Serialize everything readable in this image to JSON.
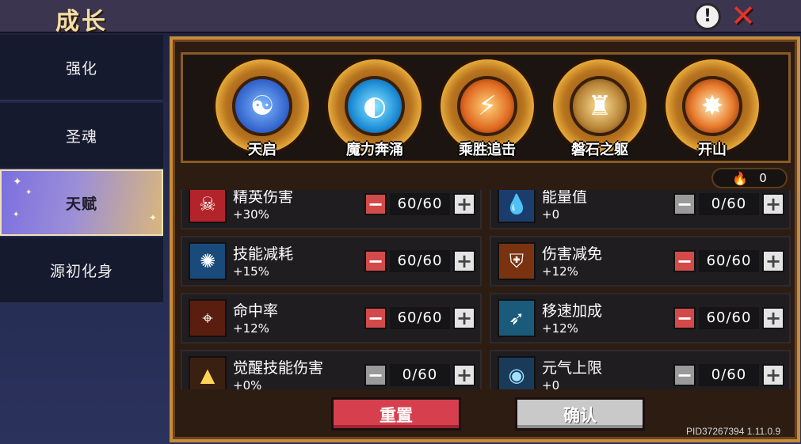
{
  "header": {
    "title": "成长",
    "info_icon": "exclamation-icon",
    "close_icon": "close-icon"
  },
  "sidebar": {
    "items": [
      {
        "label": "强化"
      },
      {
        "label": "圣魂"
      },
      {
        "label": "天赋",
        "active": true
      },
      {
        "label": "源初化身"
      }
    ]
  },
  "skills": [
    {
      "label": "天启",
      "color": "#3a6fd8"
    },
    {
      "label": "魔力奔涌",
      "color": "#1f7fd1"
    },
    {
      "label": "乘胜追击",
      "color": "#d8652a"
    },
    {
      "label": "磐石之躯",
      "color": "#8a5a25"
    },
    {
      "label": "开山",
      "color": "#c8461f"
    }
  ],
  "fire_points": "0",
  "talents": [
    {
      "name": "精英伤害",
      "bonus": "+30%",
      "value": "60/60",
      "minus_active": true,
      "icon": "demon-skull-icon",
      "icon_color": "#b3242a"
    },
    {
      "name": "能量值",
      "bonus": "+0",
      "value": "0/60",
      "minus_active": false,
      "icon": "water-drop-icon",
      "icon_color": "#1a3d6e"
    },
    {
      "name": "技能减耗",
      "bonus": "+15%",
      "value": "60/60",
      "minus_active": true,
      "icon": "blue-flame-icon",
      "icon_color": "#1a4a7a"
    },
    {
      "name": "伤害减免",
      "bonus": "+12%",
      "value": "60/60",
      "minus_active": true,
      "icon": "shield-icon",
      "icon_color": "#7a3310"
    },
    {
      "name": "命中率",
      "bonus": "+12%",
      "value": "60/60",
      "minus_active": true,
      "icon": "crosshair-icon",
      "icon_color": "#5a1e10"
    },
    {
      "name": "移速加成",
      "bonus": "+12%",
      "value": "60/60",
      "minus_active": true,
      "icon": "boot-icon",
      "icon_color": "#1a5a7a"
    },
    {
      "name": "觉醒技能伤害",
      "bonus": "+0%",
      "value": "0/60",
      "minus_active": false,
      "icon": "candle-flame-icon",
      "icon_color": "#3a2010"
    },
    {
      "name": "元气上限",
      "bonus": "+0",
      "value": "0/60",
      "minus_active": false,
      "icon": "energy-orb-icon",
      "icon_color": "#1a3a5a"
    }
  ],
  "buttons": {
    "reset": "重置",
    "confirm": "确认"
  },
  "version": "PID37267394 1.11.0.9"
}
